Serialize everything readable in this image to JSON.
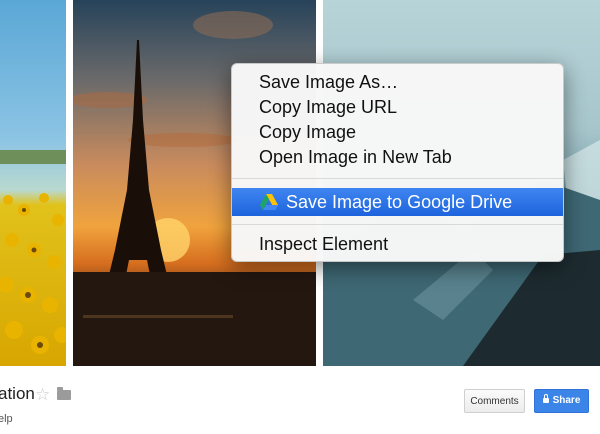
{
  "gallery": {
    "images": [
      {
        "name": "sunflower-field"
      },
      {
        "name": "eiffel-tower-sunset"
      },
      {
        "name": "mountain-lake"
      }
    ]
  },
  "context_menu": {
    "items": [
      {
        "label": "Save Image As…"
      },
      {
        "label": "Copy Image URL"
      },
      {
        "label": "Copy Image"
      },
      {
        "label": "Open Image in New Tab"
      },
      {
        "label": "Save Image to Google Drive",
        "icon": "google-drive-icon",
        "highlighted": true
      },
      {
        "label": "Inspect Element"
      }
    ]
  },
  "footer": {
    "title": "ation",
    "subtitle": "elp",
    "comments_label": "Comments",
    "share_label": "Share"
  },
  "colors": {
    "highlight": "#2a6fe6",
    "share": "#3b85e9"
  }
}
